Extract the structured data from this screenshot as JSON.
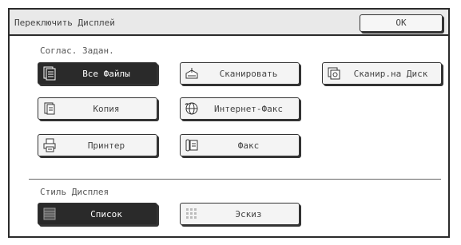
{
  "dialog": {
    "title": "Переключить Дисплей",
    "ok_label": "OK"
  },
  "job_filter": {
    "label": "Соглас. Задан.",
    "buttons": [
      {
        "label": "Все Файлы",
        "icon": "all-files-icon",
        "selected": true
      },
      {
        "label": "Сканировать",
        "icon": "scan-icon",
        "selected": false
      },
      {
        "label": "Сканир.на Диск",
        "icon": "scan-to-disk-icon",
        "selected": false
      },
      {
        "label": "Копия",
        "icon": "copy-icon",
        "selected": false
      },
      {
        "label": "Интернет-Факс",
        "icon": "internet-fax-icon",
        "selected": false
      },
      {
        "label": "Принтер",
        "icon": "printer-icon",
        "selected": false
      },
      {
        "label": "Факс",
        "icon": "fax-icon",
        "selected": false
      }
    ]
  },
  "display_style": {
    "label": "Стиль Дисплея",
    "buttons": [
      {
        "label": "Список",
        "icon": "list-view-icon",
        "selected": true
      },
      {
        "label": "Эскиз",
        "icon": "thumbnail-view-icon",
        "selected": false
      }
    ]
  },
  "colors": {
    "border": "#2b2b2b",
    "selected_bg": "#2a2a2a",
    "button_bg": "#f4f4f4",
    "titlebar_bg": "#e9e9e9"
  }
}
